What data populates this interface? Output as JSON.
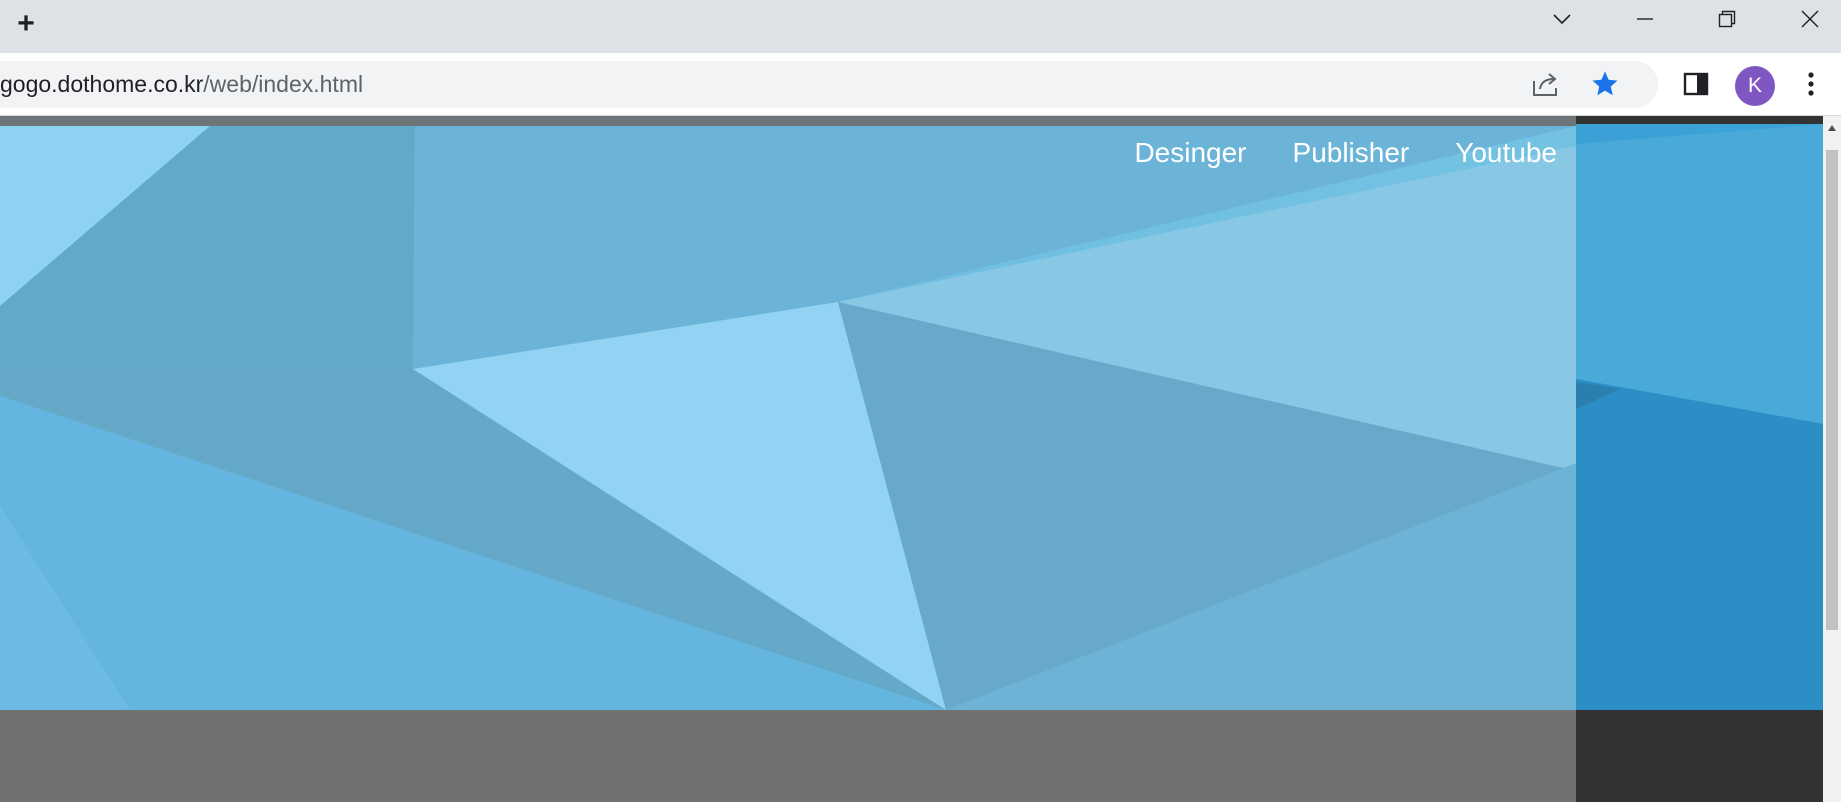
{
  "browser": {
    "url_host": "gogo.dothome.co.kr",
    "url_path": "/web/index.html",
    "profile_initial": "K",
    "icons": {
      "new_tab": "plus-icon",
      "tab_search": "chevron-down-icon",
      "minimize": "minimize-icon",
      "restore": "restore-icon",
      "close": "close-icon",
      "share": "share-icon",
      "bookmark": "star-icon",
      "side_panel": "side-panel-icon",
      "menu": "more-vert-icon"
    },
    "colors": {
      "bookmark_star": "#1a73e8",
      "avatar": "#7e57c2"
    }
  },
  "site": {
    "nav": [
      {
        "label": "Desinger"
      },
      {
        "label": "Publisher"
      },
      {
        "label": "Youtube"
      }
    ],
    "colors": {
      "hero_blue": "#6cbce0",
      "panel_blue": "#2e96cc",
      "footer_gray": "#717171",
      "panel_dark": "#333333"
    }
  }
}
